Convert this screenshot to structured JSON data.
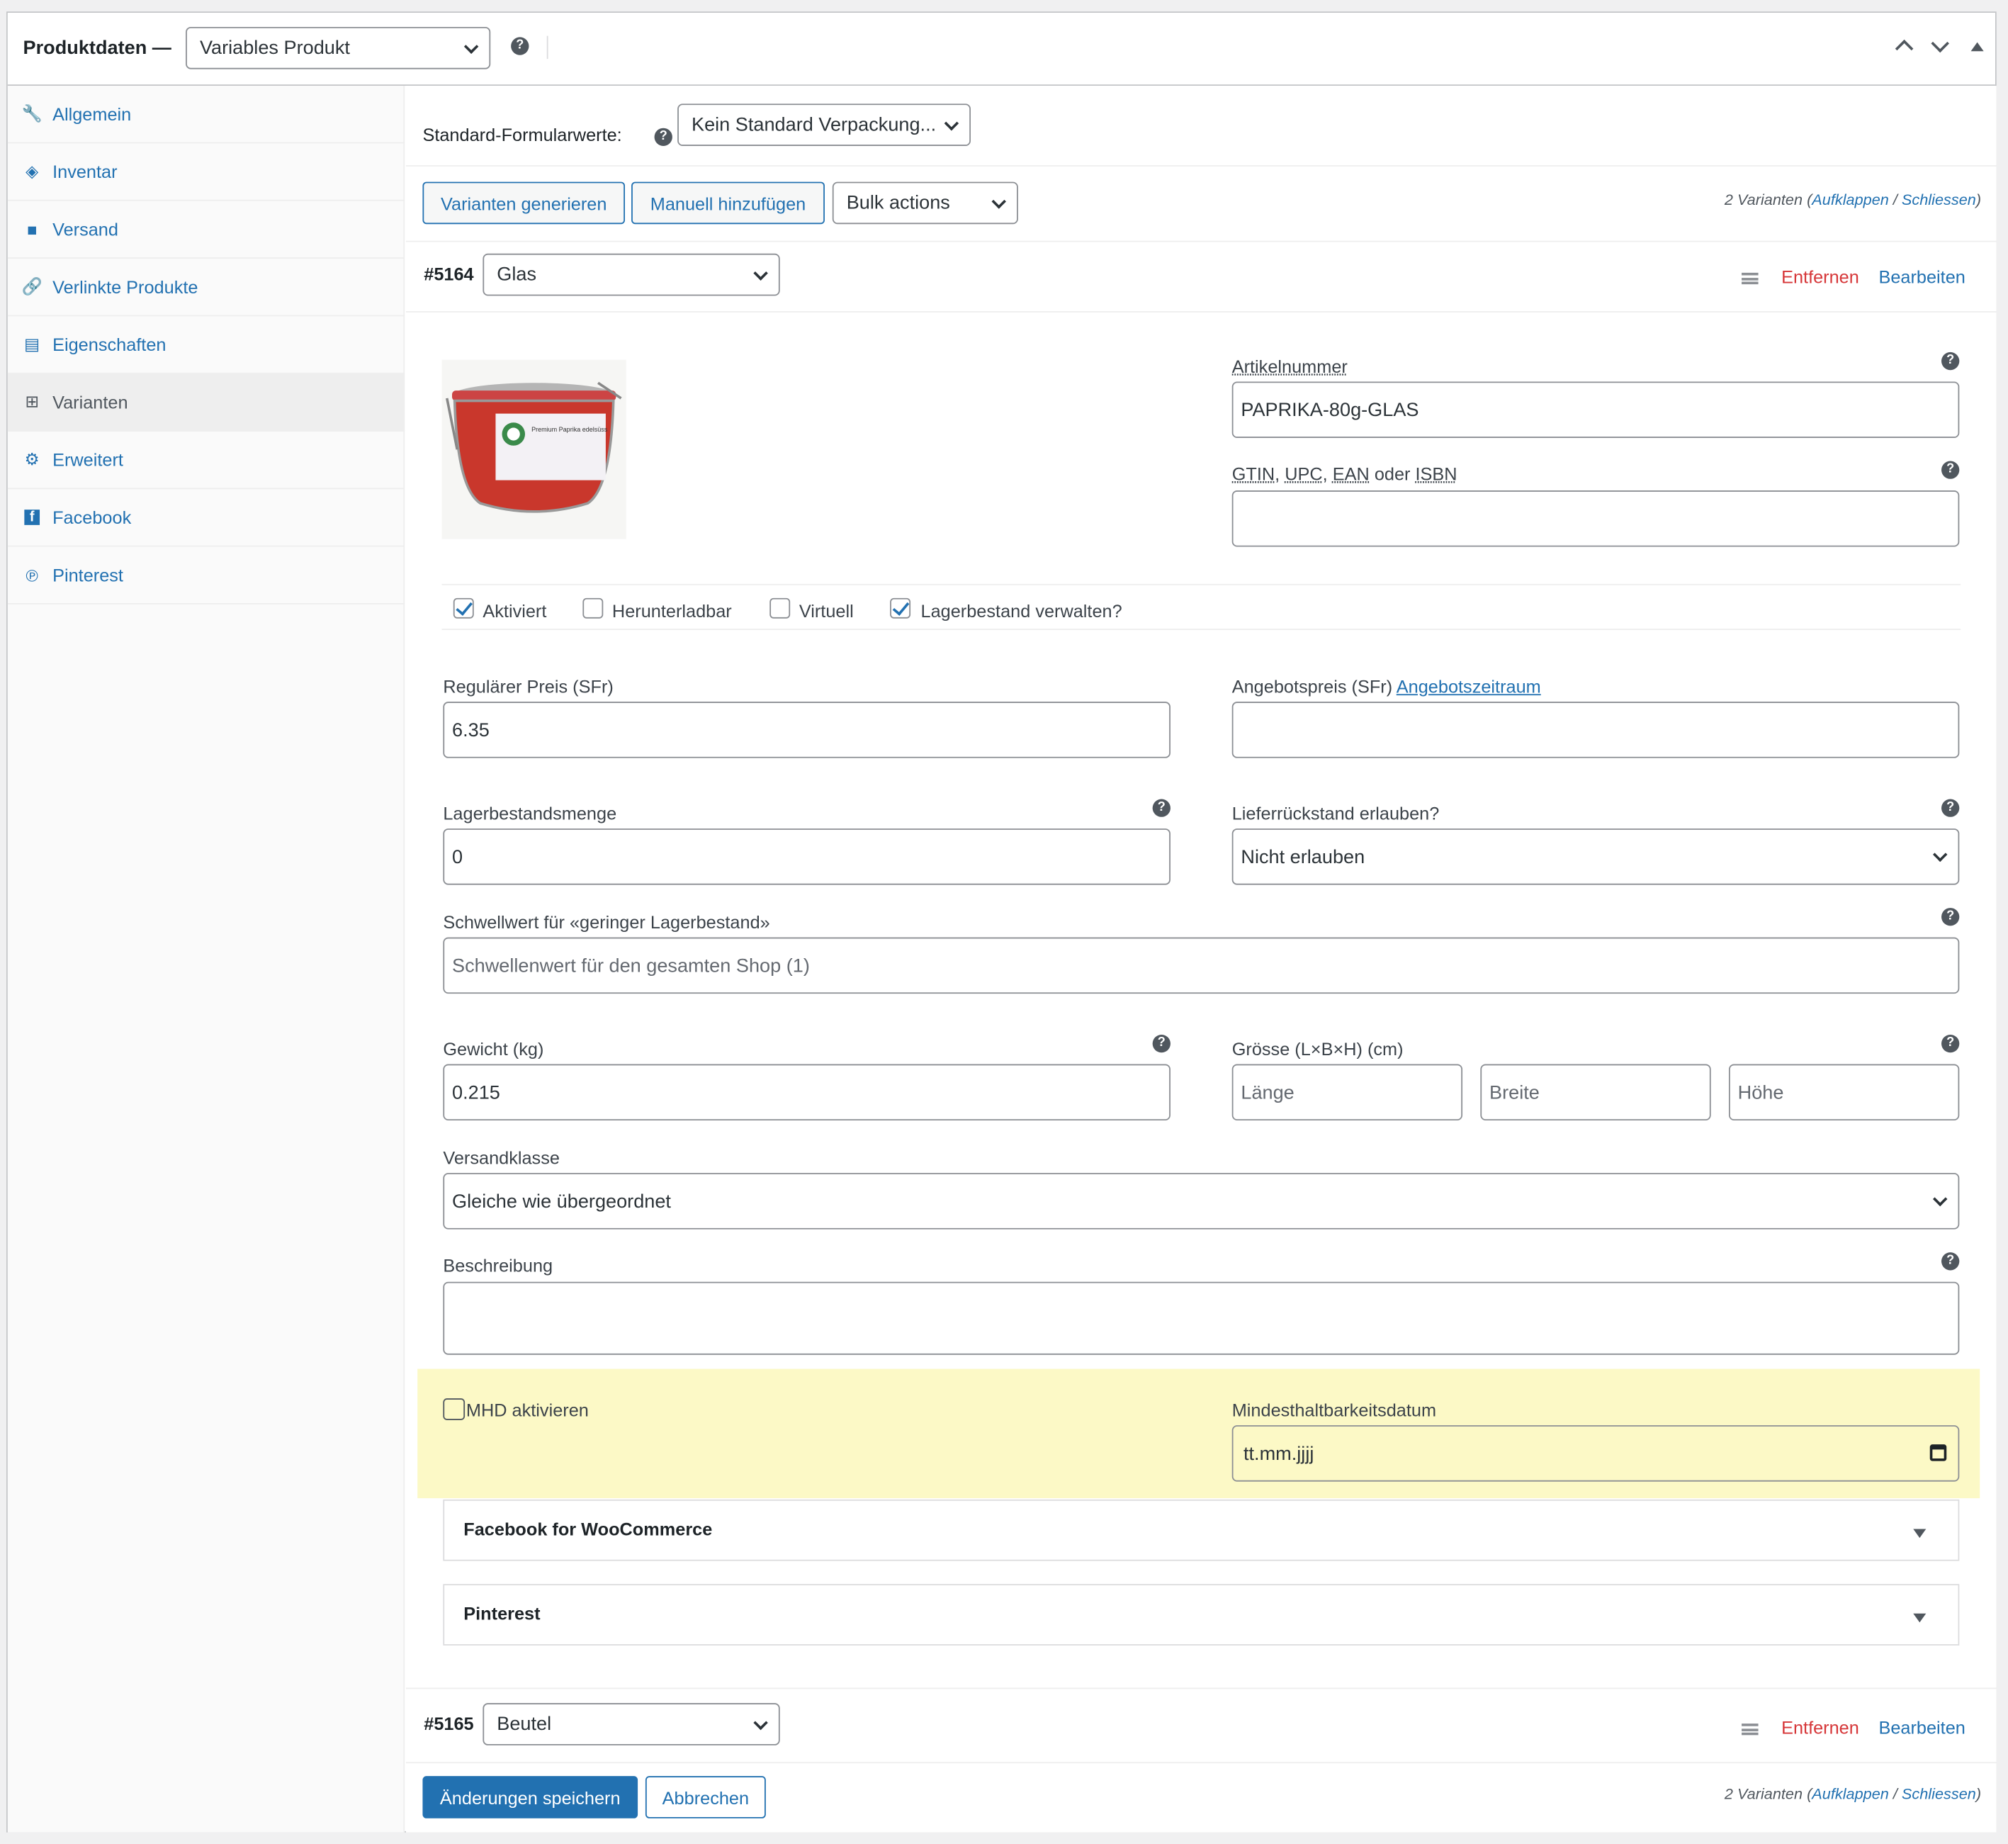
{
  "header": {
    "title": "Produktdaten —",
    "product_type": "Variables Produkt",
    "help": "?"
  },
  "sidebar": {
    "items": [
      {
        "label": "Allgemein",
        "icon": "wrench-icon",
        "glyph": "🔧"
      },
      {
        "label": "Inventar",
        "icon": "tag-icon",
        "glyph": "◈"
      },
      {
        "label": "Versand",
        "icon": "truck-icon",
        "glyph": "■"
      },
      {
        "label": "Verlinkte Produkte",
        "icon": "link-icon",
        "glyph": "🔗"
      },
      {
        "label": "Eigenschaften",
        "icon": "list-icon",
        "glyph": "▤"
      },
      {
        "label": "Varianten",
        "icon": "grid-icon",
        "glyph": "⊞"
      },
      {
        "label": "Erweitert",
        "icon": "gear-icon",
        "glyph": "⚙"
      },
      {
        "label": "Facebook",
        "icon": "facebook-icon",
        "glyph": "f"
      },
      {
        "label": "Pinterest",
        "icon": "pinterest-icon",
        "glyph": "℗"
      }
    ]
  },
  "defaults": {
    "label": "Standard-Formularwerte:",
    "value": "Kein Standard Verpackung..."
  },
  "toolbar": {
    "generate": "Varianten generieren",
    "add_manual": "Manuell hinzufügen",
    "bulk": "Bulk actions",
    "count_prefix": "2 Varianten (",
    "expand": "Aufklappen",
    "sep": " / ",
    "close": "Schliessen",
    "count_suffix": ")"
  },
  "variation1": {
    "id": "#5164",
    "value": "Glas",
    "remove": "Entfernen",
    "edit": "Bearbeiten",
    "sku_label": "Artikelnummer",
    "sku": "PAPRIKA-80g-GLAS",
    "gtin_label_a": "GTIN",
    "gtin_label_b": "UPC",
    "gtin_label_c": "EAN",
    "gtin_label_d": " oder ",
    "gtin_label_e": "ISBN",
    "cb_active": "Aktiviert",
    "cb_download": "Herunterladbar",
    "cb_virtual": "Virtuell",
    "cb_stock": "Lagerbestand verwalten?",
    "price_label": "Regulärer Preis (SFr)",
    "price": "6.35",
    "sale_label": "Angebotspreis (SFr) ",
    "sale_link": "Angebotszeitraum",
    "qty_label": "Lagerbestandsmenge",
    "qty": "0",
    "backorder_label": "Lieferrückstand erlauben?",
    "backorder": "Nicht erlauben",
    "threshold_label": "Schwellwert für «geringer Lagerbestand»",
    "threshold_ph": "Schwellenwert für den gesamten Shop (1)",
    "weight_label": "Gewicht (kg)",
    "weight": "0.215",
    "size_label": "Grösse (L×B×H) (cm)",
    "len_ph": "Länge",
    "wid_ph": "Breite",
    "hei_ph": "Höhe",
    "ship_label": "Versandklasse",
    "ship": "Gleiche wie übergeordnet",
    "desc_label": "Beschreibung",
    "mhd_label": "MHD aktivieren",
    "bbd_label": "Mindesthaltbarkeitsdatum",
    "bbd": "tt.mm.jjjj",
    "fb_title": "Facebook for WooCommerce",
    "pin_title": "Pinterest",
    "jar_label": "Premium Paprika edelsüss"
  },
  "variation2": {
    "id": "#5165",
    "value": "Beutel",
    "remove": "Entfernen",
    "edit": "Bearbeiten"
  },
  "footer": {
    "save": "Änderungen speichern",
    "cancel": "Abbrechen"
  },
  "colors": {
    "accent": "#2271b1",
    "danger": "#d63638",
    "highlight": "#fcf9c6"
  }
}
